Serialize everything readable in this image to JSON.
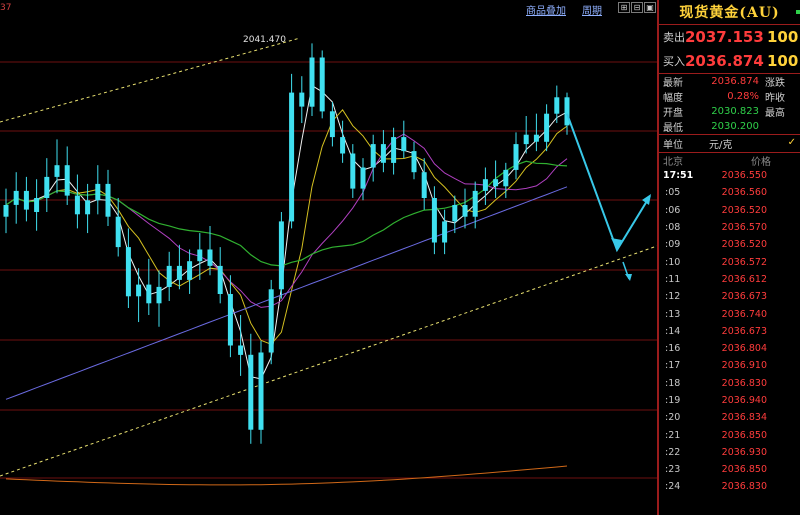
{
  "toolbar": {
    "code": "37",
    "overlay_label": "商品叠加",
    "period_label": "周期"
  },
  "panel": {
    "title": "现货黄金(AU)",
    "sell_label": "卖出",
    "sell_price": "2037.153",
    "sell_volume": "100",
    "buy_label": "买入",
    "buy_price": "2036.874",
    "buy_volume": "100",
    "stats": [
      {
        "label": "最新",
        "value": "2036.874",
        "label2": "涨跌"
      },
      {
        "label": "幅度",
        "value": "0.28%",
        "label2": "昨收"
      },
      {
        "label": "开盘",
        "value": "2030.823",
        "label2": "最高"
      },
      {
        "label": "最低",
        "value": "2030.200",
        "label2": ""
      }
    ],
    "unit_label": "单位",
    "unit_value": "元/克",
    "time_header": "北京",
    "price_header": "价格",
    "ticks": [
      {
        "time": "17:51",
        "price": "2036.550"
      },
      {
        "time": ":05",
        "price": "2036.560"
      },
      {
        "time": ":06",
        "price": "2036.520"
      },
      {
        "time": ":08",
        "price": "2036.570"
      },
      {
        "time": ":09",
        "price": "2036.520"
      },
      {
        "time": ":10",
        "price": "2036.572"
      },
      {
        "time": ":11",
        "price": "2036.612"
      },
      {
        "time": ":12",
        "price": "2036.673"
      },
      {
        "time": ":13",
        "price": "2036.740"
      },
      {
        "time": ":14",
        "price": "2036.673"
      },
      {
        "time": ":16",
        "price": "2036.804"
      },
      {
        "time": ":17",
        "price": "2036.910"
      },
      {
        "time": ":18",
        "price": "2036.830"
      },
      {
        "time": ":19",
        "price": "2036.940"
      },
      {
        "time": ":20",
        "price": "2036.834"
      },
      {
        "time": ":21",
        "price": "2036.850"
      },
      {
        "time": ":22",
        "price": "2036.930"
      },
      {
        "time": ":23",
        "price": "2036.850"
      },
      {
        "time": ":24",
        "price": "2036.830"
      }
    ]
  },
  "chart_data": {
    "type": "candlestick",
    "title": "",
    "annotations": [
      {
        "text": "2041.470",
        "kind": "peak-high"
      }
    ],
    "ylim": [
      2022.0,
      2042.5
    ],
    "grid": "horizontal",
    "colors": {
      "up": "#40e0f0",
      "down": "#40e0f0",
      "ma_fast": "#f0f0f0",
      "ma_mid": "#d4c020",
      "ma_purple": "#b040c0",
      "ma_green": "#30b030",
      "ma_blue": "#6a6ae0",
      "ma_orange": "#d06818",
      "channel": "#e8e070",
      "projection": "#38c8e8",
      "grid": "#6e1010"
    },
    "candles": [
      [
        2034.1,
        2035.3,
        2033.4,
        2034.6
      ],
      [
        2034.6,
        2036.0,
        2033.8,
        2035.2
      ],
      [
        2035.2,
        2035.8,
        2033.9,
        2034.4
      ],
      [
        2034.3,
        2035.7,
        2033.5,
        2034.9
      ],
      [
        2034.9,
        2036.6,
        2034.3,
        2035.8
      ],
      [
        2035.8,
        2037.4,
        2035.1,
        2036.3
      ],
      [
        2036.3,
        2037.1,
        2034.6,
        2035.0
      ],
      [
        2035.0,
        2035.9,
        2033.6,
        2034.2
      ],
      [
        2034.2,
        2035.5,
        2033.4,
        2034.8
      ],
      [
        2034.8,
        2036.3,
        2034.2,
        2035.5
      ],
      [
        2035.5,
        2036.1,
        2033.7,
        2034.1
      ],
      [
        2034.1,
        2034.9,
        2032.4,
        2032.8
      ],
      [
        2032.8,
        2033.6,
        2030.2,
        2030.7
      ],
      [
        2030.7,
        2031.9,
        2029.6,
        2031.2
      ],
      [
        2031.2,
        2032.3,
        2029.9,
        2030.4
      ],
      [
        2030.4,
        2031.8,
        2029.4,
        2031.1
      ],
      [
        2031.1,
        2032.6,
        2030.5,
        2032.0
      ],
      [
        2032.0,
        2032.9,
        2031.0,
        2031.4
      ],
      [
        2031.4,
        2032.7,
        2030.8,
        2032.2
      ],
      [
        2032.2,
        2033.4,
        2031.4,
        2032.7
      ],
      [
        2032.7,
        2033.7,
        2031.6,
        2032.0
      ],
      [
        2032.0,
        2032.8,
        2030.4,
        2030.8
      ],
      [
        2030.8,
        2031.6,
        2028.1,
        2028.6
      ],
      [
        2028.6,
        2029.9,
        2027.3,
        2028.2
      ],
      [
        2028.2,
        2029.1,
        2024.4,
        2025.0
      ],
      [
        2025.0,
        2028.8,
        2024.4,
        2028.3
      ],
      [
        2028.3,
        2031.4,
        2027.8,
        2031.0
      ],
      [
        2031.0,
        2034.3,
        2030.6,
        2033.9
      ],
      [
        2033.9,
        2040.2,
        2033.6,
        2039.4
      ],
      [
        2039.4,
        2040.1,
        2038.1,
        2038.8
      ],
      [
        2038.8,
        2041.5,
        2038.4,
        2040.9
      ],
      [
        2040.9,
        2041.2,
        2038.3,
        2038.6
      ],
      [
        2038.6,
        2039.0,
        2037.1,
        2037.5
      ],
      [
        2037.5,
        2038.2,
        2036.4,
        2036.8
      ],
      [
        2036.8,
        2037.2,
        2034.9,
        2035.3
      ],
      [
        2035.3,
        2036.6,
        2034.8,
        2036.2
      ],
      [
        2036.2,
        2037.6,
        2035.6,
        2037.2
      ],
      [
        2037.2,
        2037.8,
        2036.0,
        2036.4
      ],
      [
        2036.4,
        2037.9,
        2035.9,
        2037.5
      ],
      [
        2037.5,
        2038.2,
        2036.6,
        2036.9
      ],
      [
        2036.9,
        2037.3,
        2035.7,
        2036.0
      ],
      [
        2036.0,
        2036.6,
        2034.4,
        2034.9
      ],
      [
        2034.9,
        2035.4,
        2032.5,
        2033.0
      ],
      [
        2033.0,
        2034.4,
        2032.5,
        2033.9
      ],
      [
        2033.9,
        2035.0,
        2033.4,
        2034.6
      ],
      [
        2034.6,
        2035.3,
        2033.6,
        2034.1
      ],
      [
        2034.1,
        2035.6,
        2033.6,
        2035.2
      ],
      [
        2035.2,
        2036.2,
        2034.6,
        2035.7
      ],
      [
        2035.7,
        2036.5,
        2034.9,
        2035.4
      ],
      [
        2035.4,
        2036.4,
        2034.9,
        2036.1
      ],
      [
        2036.1,
        2037.7,
        2035.7,
        2037.2
      ],
      [
        2037.2,
        2038.4,
        2036.8,
        2037.6
      ],
      [
        2037.6,
        2038.5,
        2036.9,
        2037.3
      ],
      [
        2037.3,
        2038.9,
        2036.9,
        2038.5
      ],
      [
        2038.5,
        2039.7,
        2038.1,
        2039.2
      ],
      [
        2039.2,
        2039.4,
        2037.6,
        2038.0
      ]
    ]
  }
}
